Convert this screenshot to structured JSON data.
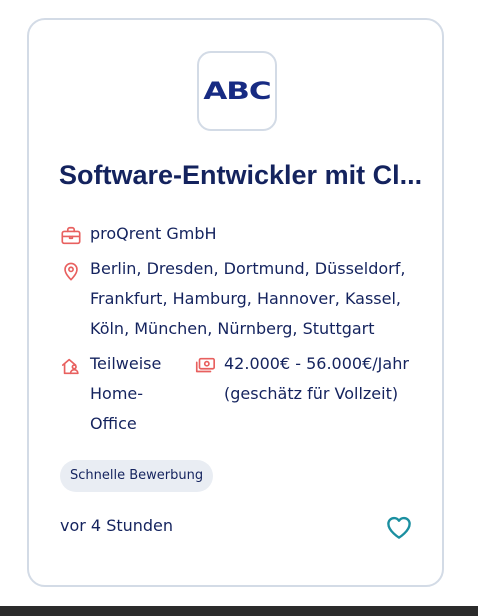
{
  "logo": {
    "text": "ABC",
    "color": "#172b83"
  },
  "job": {
    "title": "Software-Entwickler mit Cl...",
    "company": "proQrent GmbH",
    "locations": "Berlin, Dresden, Dortmund, Düsseldorf, Frankfurt, Hamburg, Hannover, Kassel, Köln, München, Nürnberg, Stuttgart",
    "work_model": "Teilweise Home-Office",
    "salary": "42.000€ - 56.000€/Jahr (geschätz für Vollzeit)"
  },
  "badge": {
    "label": "Schnelle Bewerbung"
  },
  "posted": "vor 4 Stunden",
  "icons": {
    "company": "briefcase-icon",
    "location": "map-pin-icon",
    "work_model": "home-office-icon",
    "salary": "money-icon",
    "favorite": "heart-icon"
  },
  "colors": {
    "title": "#14235e",
    "icon_accent": "#e8605f",
    "favorite": "#1b8fa0",
    "border": "#d3dbe6",
    "badge_bg": "#e9edf3"
  }
}
